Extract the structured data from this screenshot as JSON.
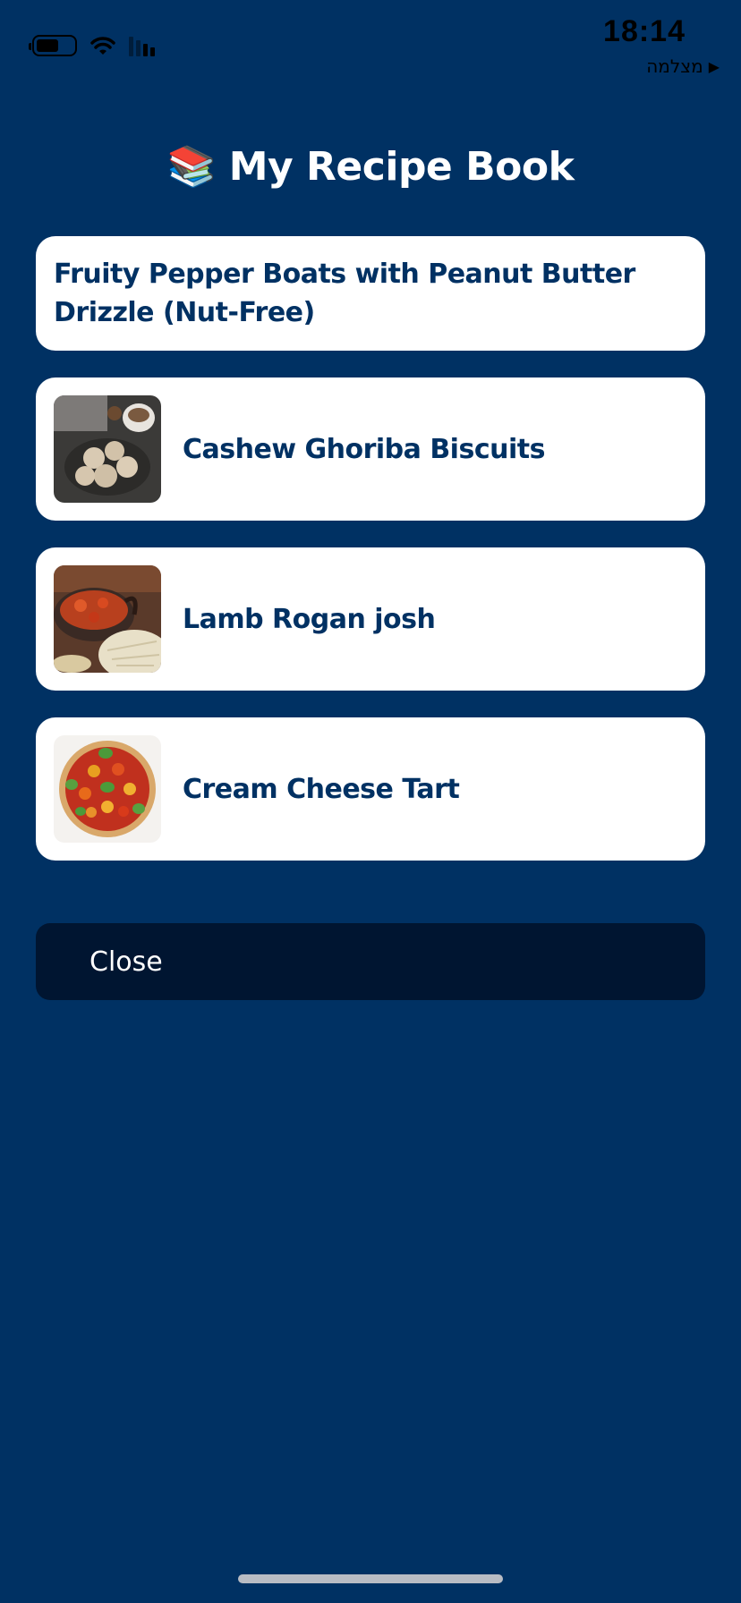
{
  "status_bar": {
    "time": "18:14",
    "back_label": "מצלמה",
    "back_arrow": "▶"
  },
  "header": {
    "emoji": "📚",
    "title": "My Recipe Book"
  },
  "recipes": [
    {
      "name": "Fruity Pepper Boats with Peanut Butter Drizzle (Nut-Free)",
      "has_image": false
    },
    {
      "name": "Cashew Ghoriba Biscuits",
      "has_image": true,
      "image": "cookies-photo"
    },
    {
      "name": "Lamb Rogan josh",
      "has_image": true,
      "image": "curry-dish-photo"
    },
    {
      "name": "Cream Cheese Tart",
      "has_image": true,
      "image": "tomato-tart-photo"
    }
  ],
  "actions": {
    "close_label": "Close"
  },
  "colors": {
    "background": "#003163",
    "card": "#ffffff",
    "card_text": "#003163",
    "close_button": "#001531"
  }
}
